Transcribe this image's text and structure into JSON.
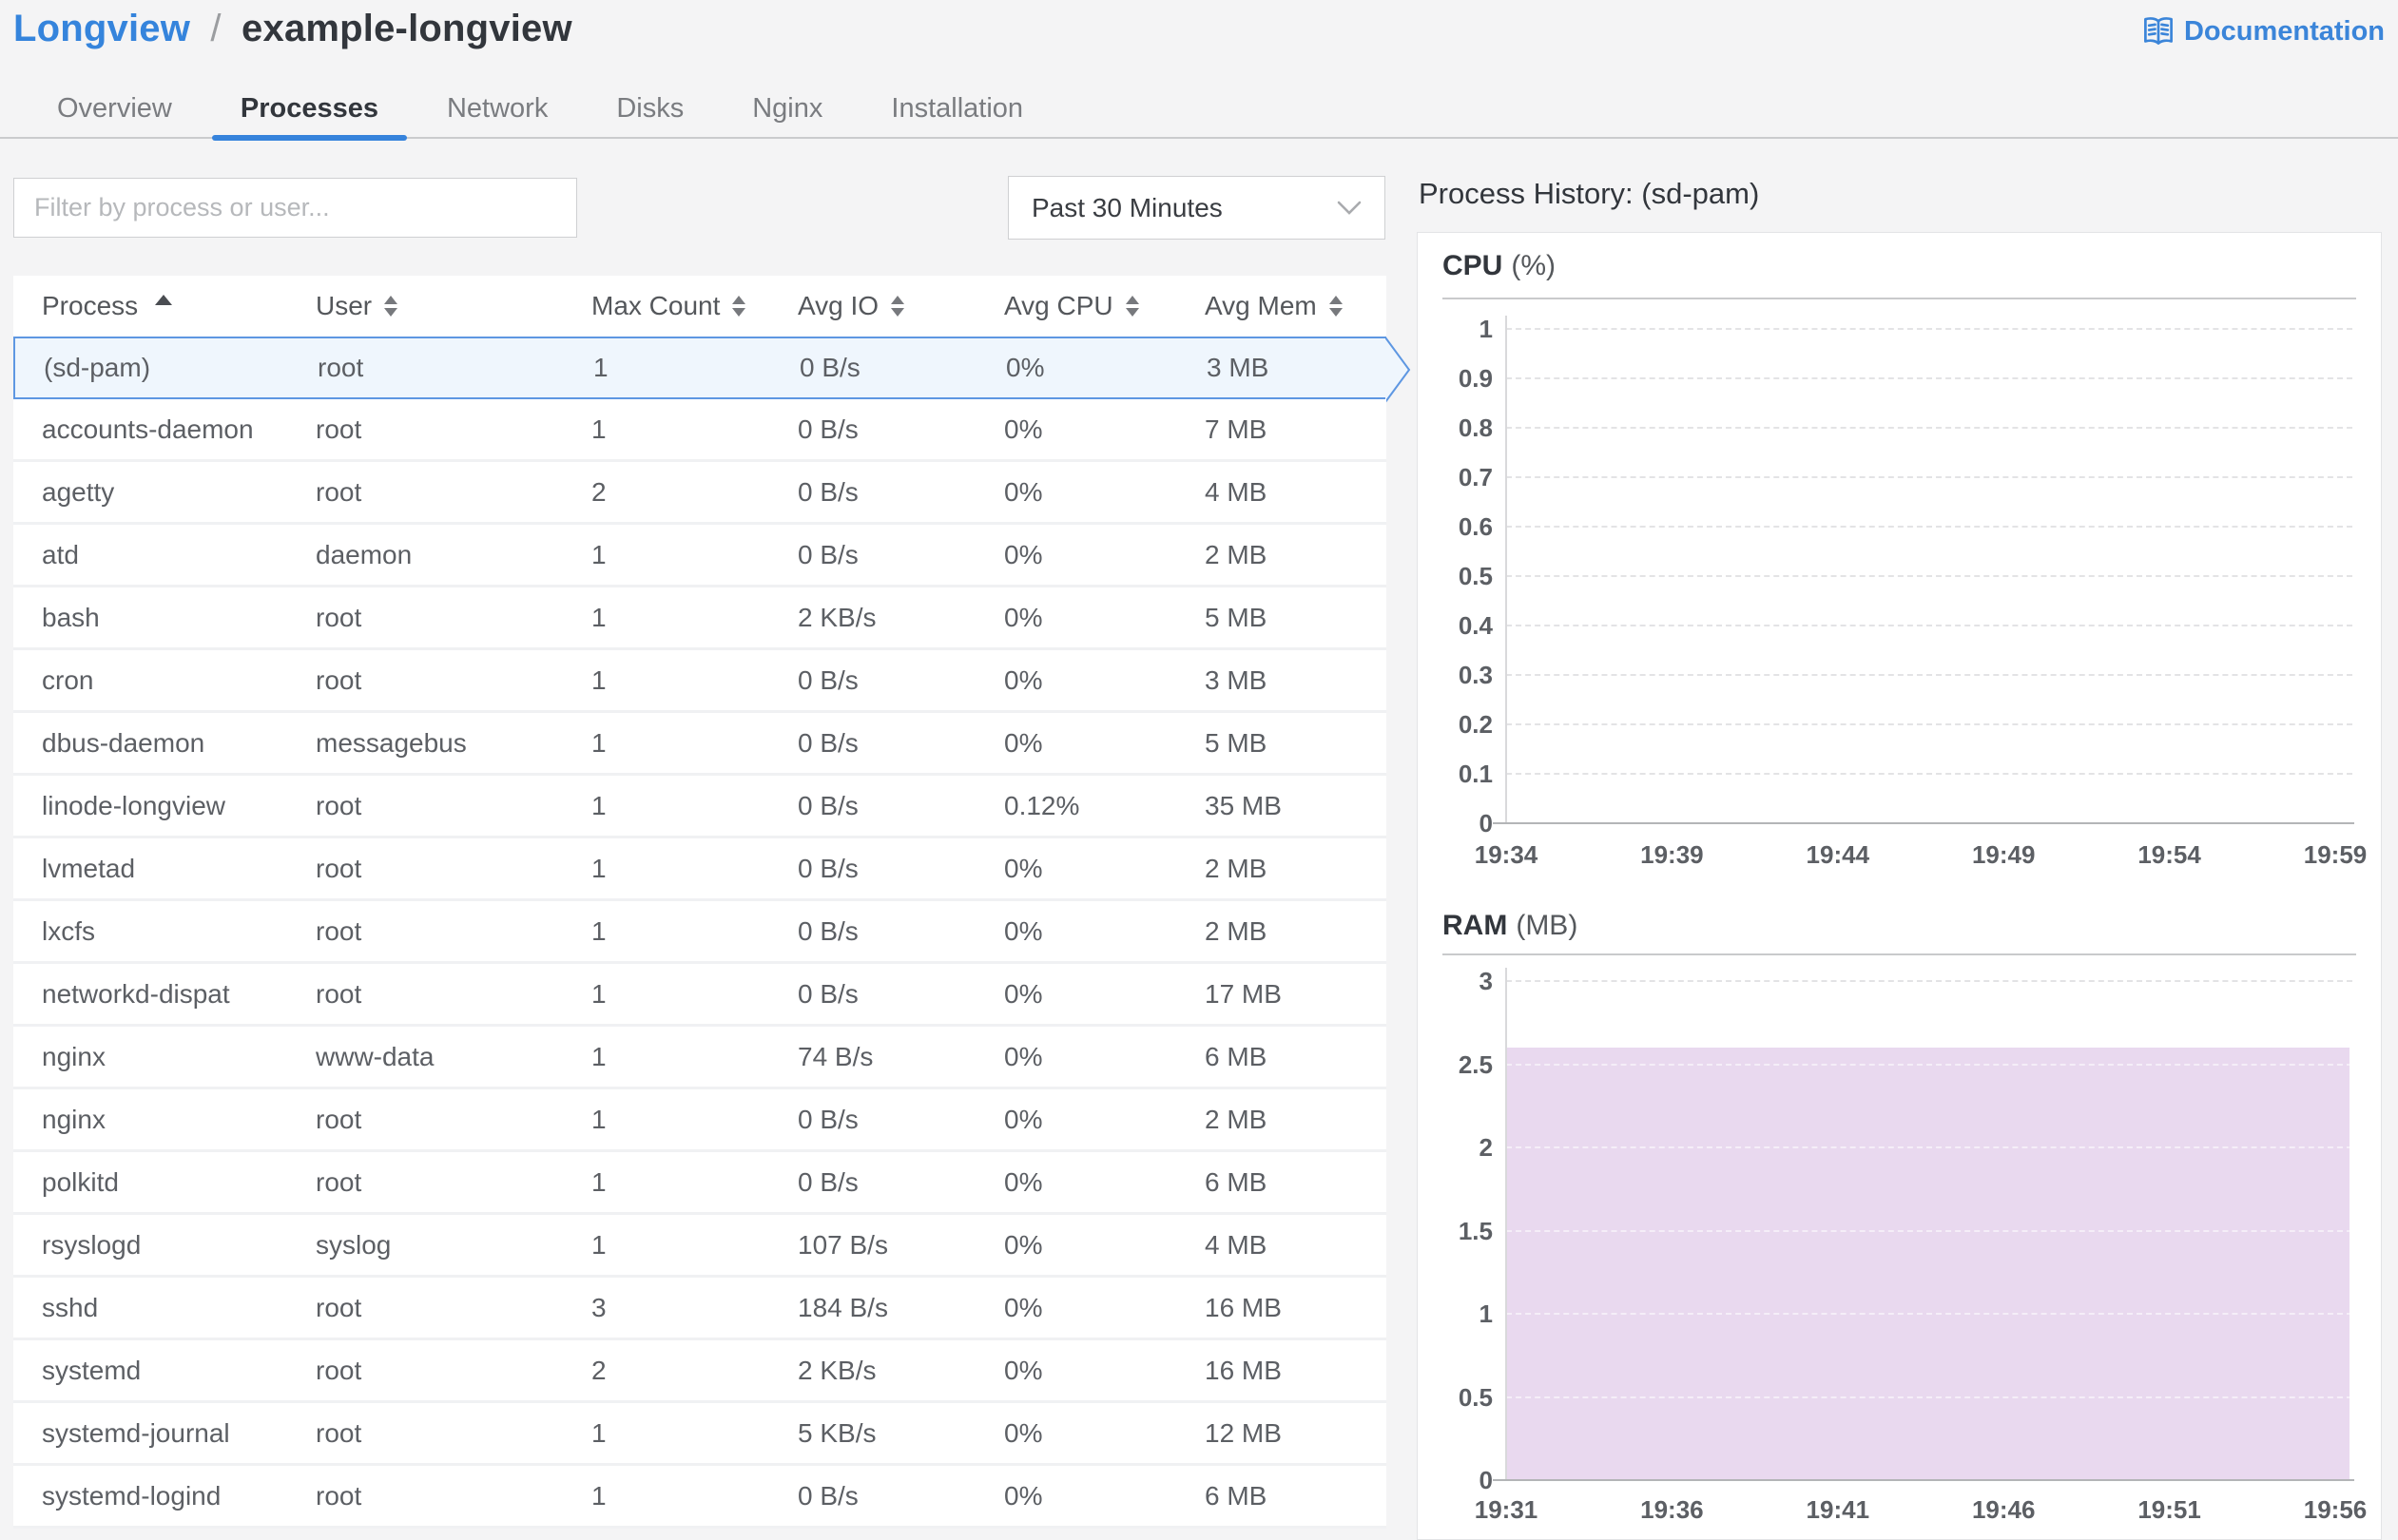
{
  "breadcrumb": {
    "root": "Longview",
    "separator": "/",
    "current": "example-longview"
  },
  "header": {
    "documentation_label": "Documentation"
  },
  "tabs": [
    {
      "label": "Overview",
      "active": false
    },
    {
      "label": "Processes",
      "active": true
    },
    {
      "label": "Network",
      "active": false
    },
    {
      "label": "Disks",
      "active": false
    },
    {
      "label": "Nginx",
      "active": false
    },
    {
      "label": "Installation",
      "active": false
    }
  ],
  "filters": {
    "search_placeholder": "Filter by process or user...",
    "time_range_value": "Past 30 Minutes"
  },
  "table": {
    "columns": [
      {
        "label": "Process",
        "sort": "asc"
      },
      {
        "label": "User",
        "sort": "both"
      },
      {
        "label": "Max Count",
        "sort": "both"
      },
      {
        "label": "Avg IO",
        "sort": "both"
      },
      {
        "label": "Avg CPU",
        "sort": "both"
      },
      {
        "label": "Avg Mem",
        "sort": "both"
      }
    ],
    "rows": [
      {
        "process": "(sd-pam)",
        "user": "root",
        "max_count": "1",
        "avg_io": "0 B/s",
        "avg_cpu": "0%",
        "avg_mem": "3 MB",
        "selected": true
      },
      {
        "process": "accounts-daemon",
        "user": "root",
        "max_count": "1",
        "avg_io": "0 B/s",
        "avg_cpu": "0%",
        "avg_mem": "7 MB",
        "selected": false
      },
      {
        "process": "agetty",
        "user": "root",
        "max_count": "2",
        "avg_io": "0 B/s",
        "avg_cpu": "0%",
        "avg_mem": "4 MB",
        "selected": false
      },
      {
        "process": "atd",
        "user": "daemon",
        "max_count": "1",
        "avg_io": "0 B/s",
        "avg_cpu": "0%",
        "avg_mem": "2 MB",
        "selected": false
      },
      {
        "process": "bash",
        "user": "root",
        "max_count": "1",
        "avg_io": "2 KB/s",
        "avg_cpu": "0%",
        "avg_mem": "5 MB",
        "selected": false
      },
      {
        "process": "cron",
        "user": "root",
        "max_count": "1",
        "avg_io": "0 B/s",
        "avg_cpu": "0%",
        "avg_mem": "3 MB",
        "selected": false
      },
      {
        "process": "dbus-daemon",
        "user": "messagebus",
        "max_count": "1",
        "avg_io": "0 B/s",
        "avg_cpu": "0%",
        "avg_mem": "5 MB",
        "selected": false
      },
      {
        "process": "linode-longview",
        "user": "root",
        "max_count": "1",
        "avg_io": "0 B/s",
        "avg_cpu": "0.12%",
        "avg_mem": "35 MB",
        "selected": false
      },
      {
        "process": "lvmetad",
        "user": "root",
        "max_count": "1",
        "avg_io": "0 B/s",
        "avg_cpu": "0%",
        "avg_mem": "2 MB",
        "selected": false
      },
      {
        "process": "lxcfs",
        "user": "root",
        "max_count": "1",
        "avg_io": "0 B/s",
        "avg_cpu": "0%",
        "avg_mem": "2 MB",
        "selected": false
      },
      {
        "process": "networkd-dispat",
        "user": "root",
        "max_count": "1",
        "avg_io": "0 B/s",
        "avg_cpu": "0%",
        "avg_mem": "17 MB",
        "selected": false
      },
      {
        "process": "nginx",
        "user": "www-data",
        "max_count": "1",
        "avg_io": "74 B/s",
        "avg_cpu": "0%",
        "avg_mem": "6 MB",
        "selected": false
      },
      {
        "process": "nginx",
        "user": "root",
        "max_count": "1",
        "avg_io": "0 B/s",
        "avg_cpu": "0%",
        "avg_mem": "2 MB",
        "selected": false
      },
      {
        "process": "polkitd",
        "user": "root",
        "max_count": "1",
        "avg_io": "0 B/s",
        "avg_cpu": "0%",
        "avg_mem": "6 MB",
        "selected": false
      },
      {
        "process": "rsyslogd",
        "user": "syslog",
        "max_count": "1",
        "avg_io": "107 B/s",
        "avg_cpu": "0%",
        "avg_mem": "4 MB",
        "selected": false
      },
      {
        "process": "sshd",
        "user": "root",
        "max_count": "3",
        "avg_io": "184 B/s",
        "avg_cpu": "0%",
        "avg_mem": "16 MB",
        "selected": false
      },
      {
        "process": "systemd",
        "user": "root",
        "max_count": "2",
        "avg_io": "2 KB/s",
        "avg_cpu": "0%",
        "avg_mem": "16 MB",
        "selected": false
      },
      {
        "process": "systemd-journal",
        "user": "root",
        "max_count": "1",
        "avg_io": "5 KB/s",
        "avg_cpu": "0%",
        "avg_mem": "12 MB",
        "selected": false
      },
      {
        "process": "systemd-logind",
        "user": "root",
        "max_count": "1",
        "avg_io": "0 B/s",
        "avg_cpu": "0%",
        "avg_mem": "6 MB",
        "selected": false
      }
    ]
  },
  "history": {
    "title": "Process History: (sd-pam)"
  },
  "chart_data": [
    {
      "type": "area",
      "title": "CPU",
      "unit": "(%)",
      "x": [
        "19:34",
        "19:39",
        "19:44",
        "19:49",
        "19:54",
        "19:59"
      ],
      "series": [
        {
          "name": "CPU",
          "values": [
            0,
            0,
            0,
            0,
            0,
            0
          ]
        }
      ],
      "ylim": [
        0,
        1
      ],
      "yticks": [
        "1",
        "0.9",
        "0.8",
        "0.7",
        "0.6",
        "0.5",
        "0.4",
        "0.3",
        "0.2",
        "0.1",
        "0"
      ],
      "grid": "horizontal-dashed",
      "legend": "none",
      "fill_color": null
    },
    {
      "type": "area",
      "title": "RAM",
      "unit": "(MB)",
      "x": [
        "19:31",
        "19:36",
        "19:41",
        "19:46",
        "19:51",
        "19:56"
      ],
      "series": [
        {
          "name": "RAM",
          "values": [
            2.6,
            2.6,
            2.6,
            2.6,
            2.6,
            2.6
          ]
        }
      ],
      "ylim": [
        0,
        3
      ],
      "yticks": [
        "3",
        "2.5",
        "2",
        "1.5",
        "1",
        "0.5",
        "0"
      ],
      "grid": "horizontal-dashed",
      "legend": "none",
      "fill_color": "#e9d9ef"
    }
  ],
  "colors": {
    "accent_blue": "#3683dc",
    "link_blue": "#3b85d9",
    "selected_row_border": "#5e97e2",
    "selected_row_bg": "#eff6fd",
    "ram_area_fill": "#e9d9ef"
  }
}
